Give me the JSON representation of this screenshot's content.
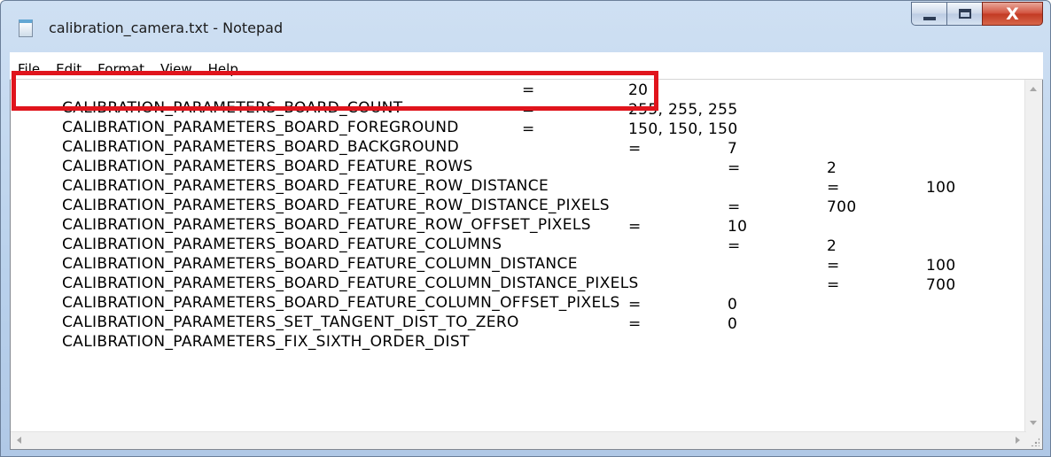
{
  "window": {
    "title": "calibration_camera.txt - Notepad",
    "close_glyph": "X",
    "icons": {
      "app": "notepad-icon",
      "minimize": "minimize-icon",
      "maximize": "maximize-icon",
      "close": "close-icon"
    }
  },
  "menu": {
    "items": [
      "File",
      "Edit",
      "Format",
      "View",
      "Help"
    ]
  },
  "editor": {
    "lines": [
      {
        "key": "CALIBRATION_PARAMETERS_BOARD_COUNT",
        "eq": "=",
        "value": "20"
      },
      {
        "key": "CALIBRATION_PARAMETERS_BOARD_FOREGROUND",
        "eq": "=",
        "value": "255, 255, 255"
      },
      {
        "key": "CALIBRATION_PARAMETERS_BOARD_BACKGROUND",
        "eq": "=",
        "value": "150, 150, 150"
      },
      {
        "key": "CALIBRATION_PARAMETERS_BOARD_FEATURE_ROWS",
        "eq": "=",
        "value": "7"
      },
      {
        "key": "CALIBRATION_PARAMETERS_BOARD_FEATURE_ROW_DISTANCE",
        "eq": "=",
        "value": "2"
      },
      {
        "key": "CALIBRATION_PARAMETERS_BOARD_FEATURE_ROW_DISTANCE_PIXELS",
        "eq": "=",
        "value": "100"
      },
      {
        "key": "CALIBRATION_PARAMETERS_BOARD_FEATURE_ROW_OFFSET_PIXELS",
        "eq": "=",
        "value": "700"
      },
      {
        "key": "CALIBRATION_PARAMETERS_BOARD_FEATURE_COLUMNS",
        "eq": "=",
        "value": "10"
      },
      {
        "key": "CALIBRATION_PARAMETERS_BOARD_FEATURE_COLUMN_DISTANCE",
        "eq": "=",
        "value": "2"
      },
      {
        "key": "CALIBRATION_PARAMETERS_BOARD_FEATURE_COLUMN_DISTANCE_PIXELS",
        "eq": "=",
        "value": "100"
      },
      {
        "key": "CALIBRATION_PARAMETERS_BOARD_FEATURE_COLUMN_OFFSET_PIXELS",
        "eq": "=",
        "value": "700"
      },
      {
        "key": "CALIBRATION_PARAMETERS_SET_TANGENT_DIST_TO_ZERO",
        "eq": "=",
        "value": "0"
      },
      {
        "key": "CALIBRATION_PARAMETERS_FIX_SIXTH_ORDER_DIST",
        "eq": "=",
        "value": "0"
      }
    ]
  },
  "annotation": {
    "highlight_color": "#e0141c"
  }
}
